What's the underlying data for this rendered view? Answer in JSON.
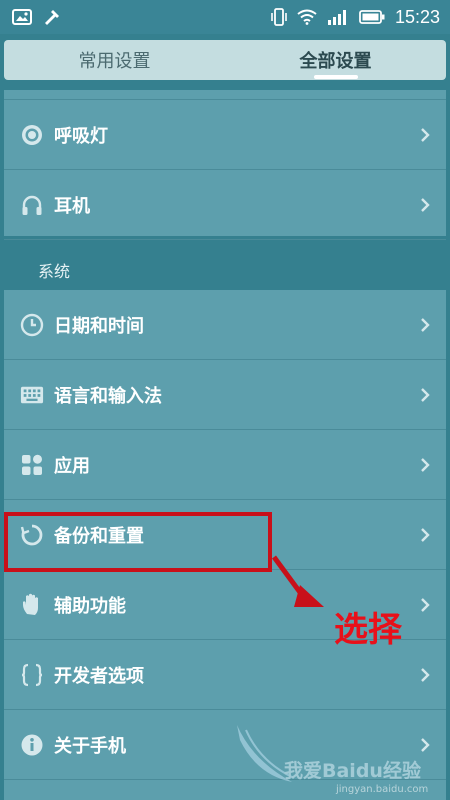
{
  "status_bar": {
    "time": "15:23",
    "left_icons": [
      "image-icon",
      "tool-icon"
    ],
    "right_icons": [
      "vibrate-icon",
      "wifi-icon",
      "signal-icon",
      "battery-icon"
    ]
  },
  "tabs": [
    {
      "label": "常用设置",
      "active": false
    },
    {
      "label": "全部设置",
      "active": true
    }
  ],
  "top_list": [
    {
      "label": "呼吸灯",
      "icon": "breathing-light-icon"
    },
    {
      "label": "耳机",
      "icon": "headphones-icon"
    }
  ],
  "section_header": "系统",
  "system_list": [
    {
      "label": "日期和时间",
      "icon": "clock-icon"
    },
    {
      "label": "语言和输入法",
      "icon": "keyboard-icon"
    },
    {
      "label": "应用",
      "icon": "apps-icon"
    },
    {
      "label": "备份和重置",
      "icon": "backup-icon"
    },
    {
      "label": "辅助功能",
      "icon": "hand-icon"
    },
    {
      "label": "开发者选项",
      "icon": "braces-icon"
    },
    {
      "label": "关于手机",
      "icon": "info-icon"
    }
  ],
  "annotation": {
    "label": "选择",
    "color": "#e8101a"
  },
  "watermark": {
    "text": "我爱Baidu经验",
    "url": "jingyan.baidu.com"
  }
}
